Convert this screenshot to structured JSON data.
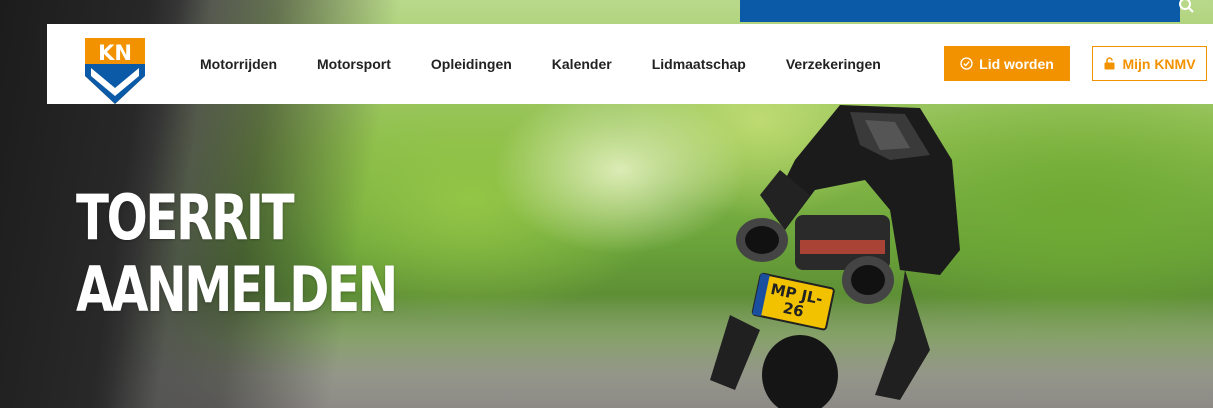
{
  "header": {
    "logo_text": "KNMV",
    "nav": [
      {
        "label": "Motorrijden"
      },
      {
        "label": "Motorsport"
      },
      {
        "label": "Opleidingen"
      },
      {
        "label": "Kalender"
      },
      {
        "label": "Lidmaatschap"
      },
      {
        "label": "Verzekeringen"
      }
    ],
    "cta_primary": {
      "label": "Lid worden",
      "icon": "check-circle-icon"
    },
    "cta_secondary": {
      "label": "Mijn KNMV",
      "icon": "lock-icon"
    },
    "search_icon": "search-icon"
  },
  "hero": {
    "title_line1": "TOERRIT",
    "title_line2": "AANMELDEN",
    "plate": "MP JL-26"
  },
  "colors": {
    "orange": "#f39200",
    "blue": "#0a5aa8",
    "nav_text": "#222222"
  }
}
